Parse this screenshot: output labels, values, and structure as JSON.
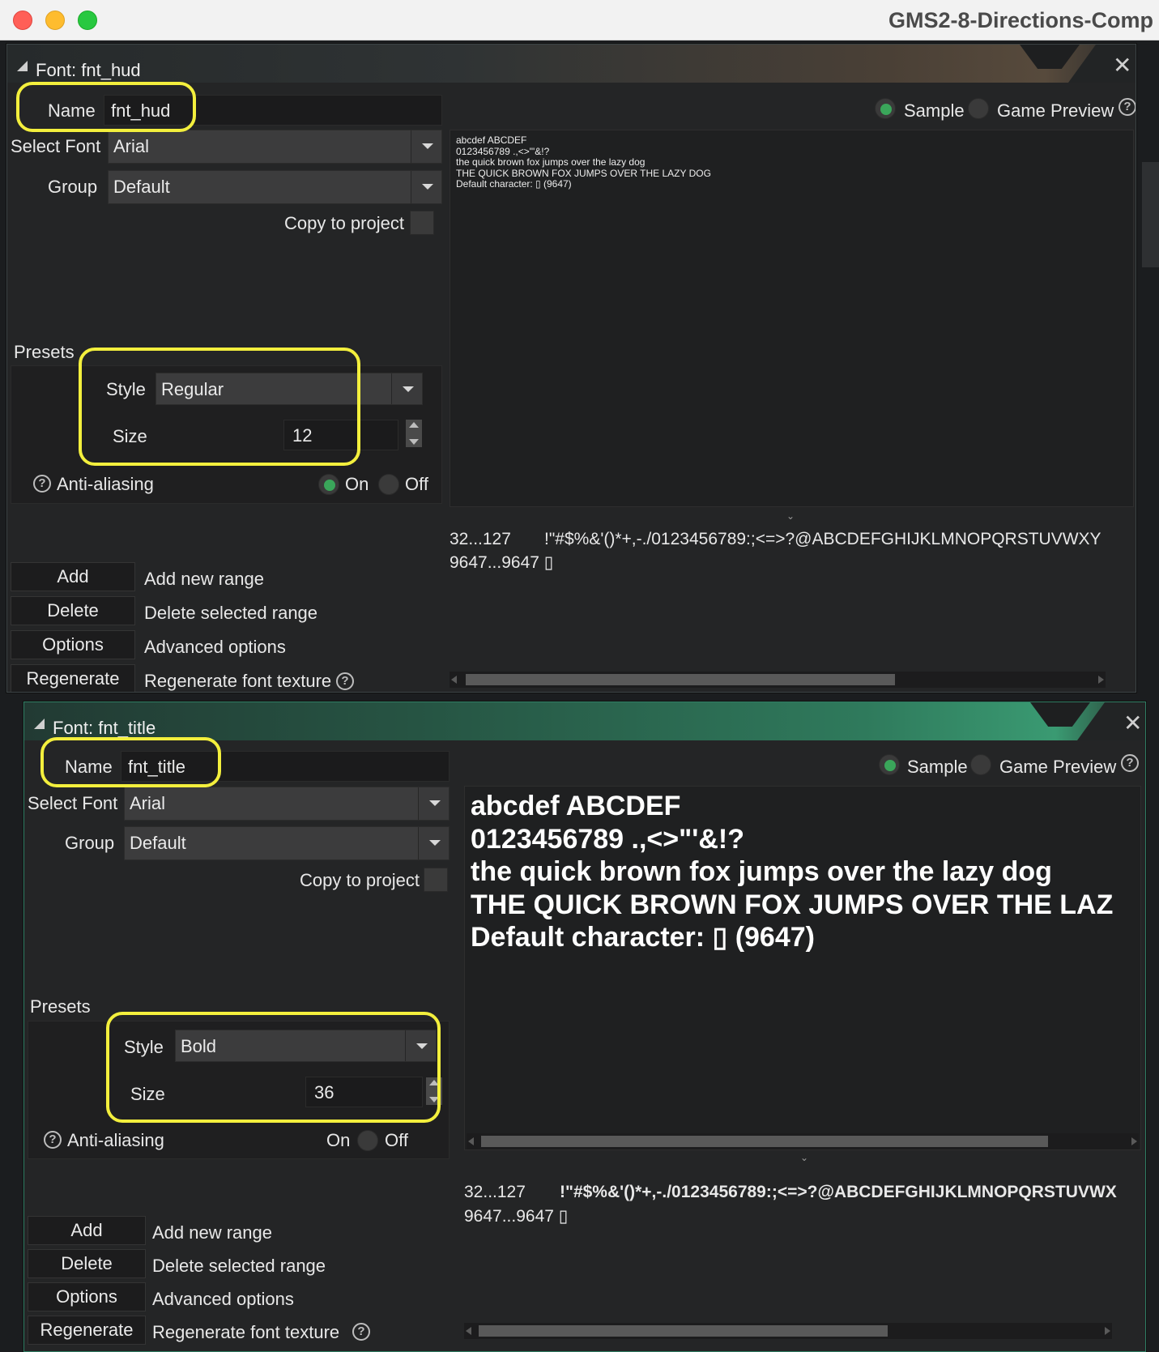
{
  "window": {
    "title": "GMS2-8-Directions-Comp"
  },
  "panel1": {
    "title": "Font: fnt_hud",
    "name_label": "Name",
    "name_value": "fnt_hud",
    "select_font_label": "Select Font",
    "select_font_value": "Arial",
    "group_label": "Group",
    "group_value": "Default",
    "copy_label": "Copy to project",
    "presets_label": "Presets",
    "style_label": "Style",
    "style_value": "Regular",
    "size_label": "Size",
    "size_value": "12",
    "aa_label": "Anti-aliasing",
    "aa_on": "On",
    "aa_off": "Off",
    "aa_selected": "On",
    "sample_label": "Sample",
    "game_preview_label": "Game Preview",
    "view_selected": "Sample",
    "preview_lines": [
      "abcdef ABCDEF",
      "0123456789 .,<>\"'&!?",
      "the quick brown fox jumps over the lazy dog",
      "THE QUICK BROWN FOX JUMPS OVER THE LAZY DOG",
      "Default character: ▯ (9647)"
    ],
    "ranges": [
      {
        "range": "32...127",
        "chars": "!\"#$%&'()*+,-./0123456789:;<=>?@ABCDEFGHIJKLMNOPQRSTUVWXY"
      },
      {
        "range": "9647...9647",
        "chars": "▯"
      }
    ],
    "buttons": [
      {
        "label": "Add",
        "desc": "Add new range"
      },
      {
        "label": "Delete",
        "desc": "Delete selected range"
      },
      {
        "label": "Options",
        "desc": "Advanced options"
      },
      {
        "label": "Regenerate",
        "desc": "Regenerate font texture"
      }
    ]
  },
  "panel2": {
    "title": "Font: fnt_title",
    "name_label": "Name",
    "name_value": "fnt_title",
    "select_font_label": "Select Font",
    "select_font_value": "Arial",
    "group_label": "Group",
    "group_value": "Default",
    "copy_label": "Copy to project",
    "presets_label": "Presets",
    "style_label": "Style",
    "style_value": "Bold",
    "size_label": "Size",
    "size_value": "36",
    "aa_label": "Anti-aliasing",
    "aa_on": "On",
    "aa_off": "Off",
    "aa_selected": "Off",
    "sample_label": "Sample",
    "game_preview_label": "Game Preview",
    "view_selected": "Sample",
    "preview_lines": [
      "abcdef ABCDEF",
      "0123456789 .,<>\"'&!?",
      "the quick brown fox jumps over the lazy dog",
      "THE QUICK BROWN FOX JUMPS OVER THE LAZ",
      "Default character: ▯ (9647)"
    ],
    "ranges": [
      {
        "range": "32...127",
        "chars": "!\"#$%&'()*+,-./0123456789:;<=>?@ABCDEFGHIJKLMNOPQRSTUVWX"
      },
      {
        "range": "9647...9647",
        "chars": "▯"
      }
    ],
    "buttons": [
      {
        "label": "Add",
        "desc": "Add new range"
      },
      {
        "label": "Delete",
        "desc": "Delete selected range"
      },
      {
        "label": "Options",
        "desc": "Advanced options"
      },
      {
        "label": "Regenerate",
        "desc": "Regenerate font texture"
      }
    ]
  },
  "colors": {
    "highlight": "#f3ef3d",
    "radio_on": "#3aa65a",
    "panel_bg": "#242526",
    "accent_teal": "#2f7a5c"
  }
}
